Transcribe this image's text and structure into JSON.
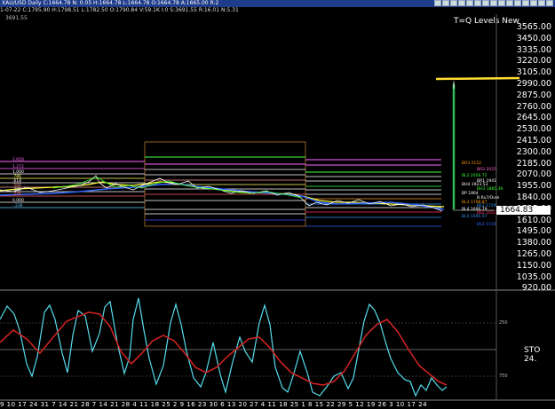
{
  "titlebar": {
    "text": "XAU/USD Daily C:1664.78 N: 0.05 H:1664.78 L:1664.78 O:1664.78 A:1665.00 R:2",
    "icons": [
      "back-icon",
      "forward-icon",
      "layout-icon",
      "chart-icon",
      "zoom-icon",
      "draw-icon",
      "settings-icon",
      "cursor-icon",
      "text-icon",
      "grid-icon",
      "sync-icon",
      "link-icon",
      "minimize-icon",
      "maximize-icon",
      "close-icon"
    ]
  },
  "infobar": {
    "text": "1-07-22  C:1795.90  H:1798.51  L:1782.50  O:1790.84  V:59.1K  I:0  S:3691.55  R:16.01  N:5.31"
  },
  "last_label": "3691.55",
  "overlay_title": "T=Q Levels New",
  "price_axis": [
    "3565.00",
    "3450.00",
    "3335.00",
    "3220.00",
    "3105.00",
    "2990.00",
    "2875.00",
    "2760.00",
    "2645.00",
    "2530.00",
    "2415.00",
    "2300.00",
    "2185.00",
    "2070.00",
    "1955.00",
    "1840.00",
    "1725.00",
    "1610.00",
    "1495.00",
    "1380.00",
    "1265.00",
    "1150.00",
    "1035.00",
    "920.00"
  ],
  "current_price": "1664.83",
  "left_levels": [
    "1.618",
    "1.272",
    "1.000",
    ".786",
    ".618",
    ".500",
    ".382",
    ".236",
    "0.000",
    "-.236"
  ],
  "right_levels": [
    {
      "text": "BR3  2152",
      "color": "#ff9900"
    },
    {
      "text": "BR2  2025",
      "color": "#ff66cc"
    },
    {
      "text": "BL2  2056.72",
      "color": "#33ff33"
    },
    {
      "text": "BR1  1941",
      "color": "#ffffff"
    },
    {
      "text": "BH4  1923.53",
      "color": "#ffffff"
    },
    {
      "text": "BH3  1885.39",
      "color": "#33ff33"
    },
    {
      "text": "BP  1864",
      "color": "#ffffff"
    },
    {
      "text": "B.Ro7/Ovre",
      "color": "#ffffff"
    },
    {
      "text": "BL3  1798.87",
      "color": "#ff9900"
    },
    {
      "text": "BS1  1729",
      "color": "#3399ff"
    },
    {
      "text": "BL4  1690.79",
      "color": "#ffffff"
    },
    {
      "text": "BS2  1652",
      "color": "#ff3366"
    },
    {
      "text": "BL5  1595.57",
      "color": "#3399ff"
    },
    {
      "text": "BS3  1516",
      "color": "#3366ff"
    }
  ],
  "oscillator": {
    "label": "STO  24.",
    "upper_tick": "250",
    "lower_tick": "750"
  },
  "x_labels": "9  10  17  24  31   7  14  21  28   7  14  21  28   4  11  18  25   2   9  16  23  30   6  13  20  27   4  11  18  25   1   8  15  22  29   5  12  19  26   3  10  17  24"
}
